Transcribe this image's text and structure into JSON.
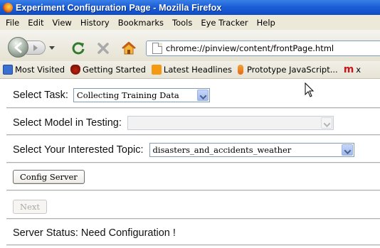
{
  "window": {
    "title": "Experiment Configuration Page - Mozilla Firefox"
  },
  "menubar": {
    "items": [
      "File",
      "Edit",
      "View",
      "History",
      "Bookmarks",
      "Tools",
      "Eye Tracker",
      "Help"
    ]
  },
  "navbar": {
    "url": "chrome://pinview/content/frontPage.html",
    "icons": [
      "back-icon",
      "forward-icon",
      "history-dropdown-icon",
      "reload-icon",
      "stop-icon",
      "home-icon",
      "page-icon"
    ]
  },
  "bookmarks": {
    "items": [
      {
        "label": "Most Visited",
        "icon": "most-visited-icon"
      },
      {
        "label": "Getting Started",
        "icon": "getting-started-icon"
      },
      {
        "label": "Latest Headlines",
        "icon": "rss-icon"
      },
      {
        "label": "Prototype JavaScript...",
        "icon": "prototype-icon"
      },
      {
        "label": "x",
        "icon": "m-icon"
      }
    ]
  },
  "form": {
    "task_label": "Select Task:",
    "task_value": "Collecting Training Data",
    "model_label": "Select Model in Testing:",
    "model_value": "",
    "topic_label": "Select Your Interested Topic:",
    "topic_value": "disasters_and_accidents_weather",
    "config_button": "Config Server",
    "next_button": "Next",
    "status_text": "Server Status: Need Configuration !"
  },
  "colors": {
    "titlebar": "#1c5fd5",
    "chrome": "#ece9d8",
    "separator": "#b0b0b0",
    "select_border": "#7f9db9"
  }
}
